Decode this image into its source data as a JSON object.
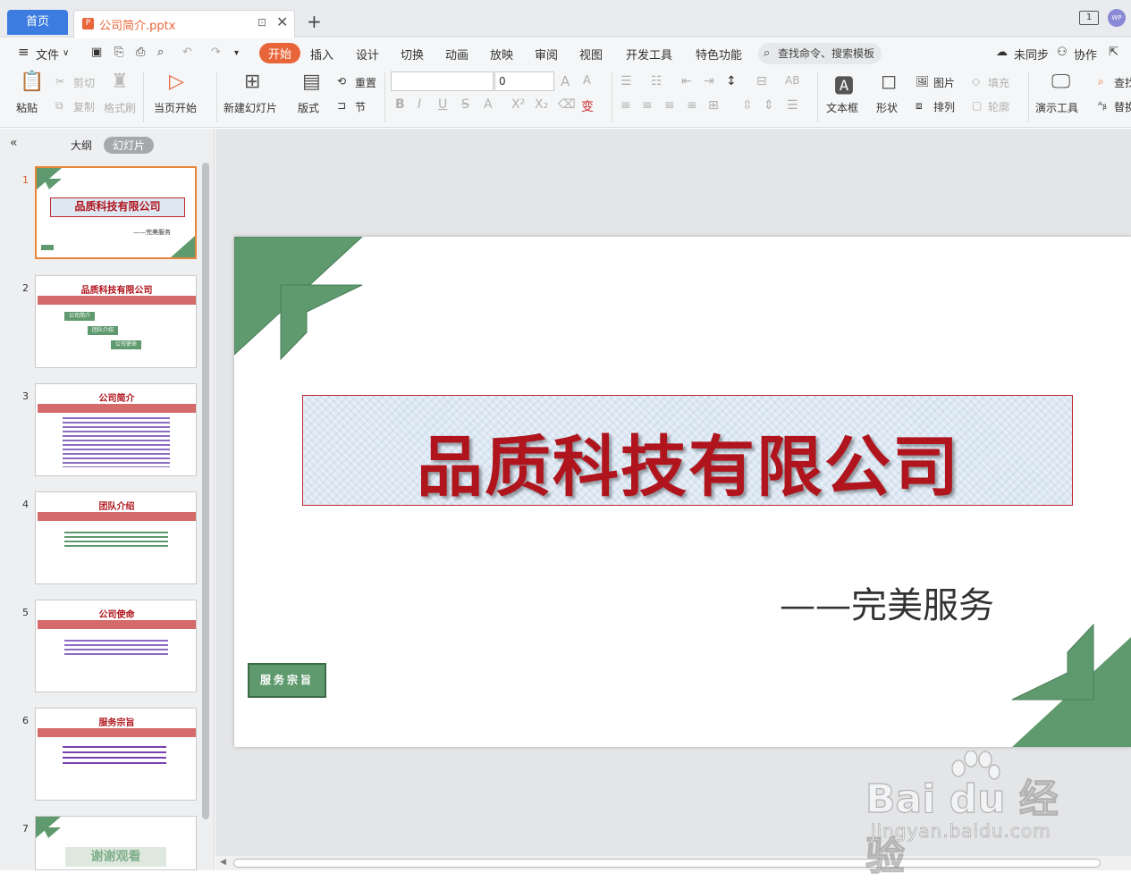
{
  "titlebar": {
    "home_tab": "首页",
    "doc_tab": "公司简介.pptx",
    "doc_icon": "P",
    "new_tab": "+",
    "window_badge": "1",
    "avatar": "WP"
  },
  "menubar": {
    "file": "文件",
    "items": [
      "开始",
      "插入",
      "设计",
      "切换",
      "动画",
      "放映",
      "审阅",
      "视图",
      "开发工具",
      "特色功能"
    ],
    "search_placeholder": "查找命令、搜索模板",
    "sync": "未同步",
    "collab": "协作"
  },
  "ribbon": {
    "paste": "粘贴",
    "cut": "剪切",
    "copy": "复制",
    "format_painter": "格式刷",
    "play_from_current": "当页开始",
    "new_slide": "新建幻灯片",
    "layout": "版式",
    "reset": "重置",
    "section": "节",
    "font_size": "0",
    "text_box": "文本框",
    "shape": "形状",
    "picture": "图片",
    "fill": "填充",
    "arrange": "排列",
    "outline": "轮廓",
    "present_tools": "演示工具",
    "find": "查找",
    "replace": "替换"
  },
  "panel": {
    "tab_outline": "大纲",
    "tab_slides": "幻灯片",
    "slides": [
      {
        "num": "1",
        "title": "品质科技有限公司",
        "subtitle": "——完美服务"
      },
      {
        "num": "2",
        "title": "品质科技有限公司",
        "items": [
          "公司简介",
          "团队介绍",
          "公司使命"
        ]
      },
      {
        "num": "3",
        "title": "公司简介"
      },
      {
        "num": "4",
        "title": "团队介绍"
      },
      {
        "num": "5",
        "title": "公司使命"
      },
      {
        "num": "6",
        "title": "服务宗旨"
      },
      {
        "num": "7",
        "title": "谢谢观看"
      }
    ]
  },
  "slide": {
    "title": "品质科技有限公司",
    "subtitle": "——完美服务",
    "button": "服务宗旨"
  },
  "watermark": {
    "brand": "Bai du 经验",
    "url": "jingyan.baidu.com"
  }
}
